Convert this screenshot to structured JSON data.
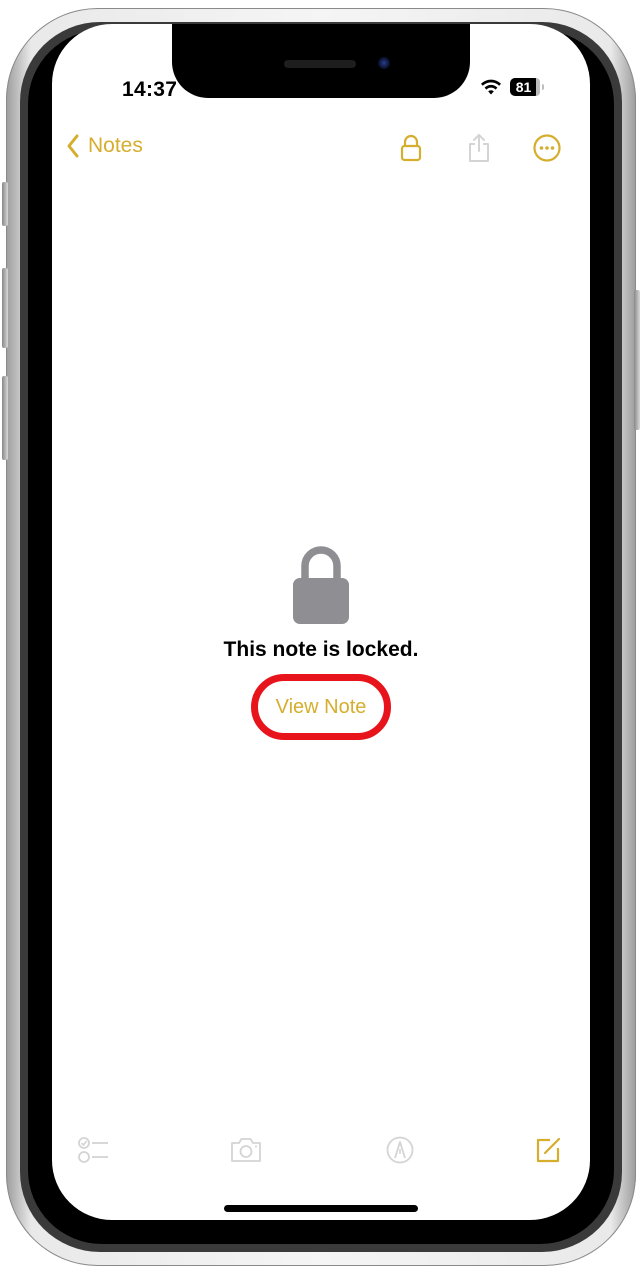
{
  "status_bar": {
    "time": "14:37",
    "battery_level": "81",
    "wifi_icon": "wifi-icon"
  },
  "nav": {
    "back_label": "Notes",
    "back_icon": "chevron-left-icon",
    "actions": [
      {
        "name": "lock",
        "icon": "lock-icon",
        "enabled": true
      },
      {
        "name": "share",
        "icon": "share-icon",
        "enabled": false
      },
      {
        "name": "more",
        "icon": "ellipsis-circle-icon",
        "enabled": true
      }
    ]
  },
  "content": {
    "locked_message": "This note is locked.",
    "view_note_label": "View Note",
    "lock_icon": "lock-icon"
  },
  "toolbar": {
    "items": [
      {
        "name": "checklist",
        "icon": "checklist-icon",
        "enabled": false
      },
      {
        "name": "camera",
        "icon": "camera-icon",
        "enabled": false
      },
      {
        "name": "markup",
        "icon": "markup-pen-icon",
        "enabled": false
      },
      {
        "name": "compose",
        "icon": "compose-icon",
        "enabled": true
      }
    ]
  },
  "colors": {
    "accent": "#d6ae2e",
    "disabled": "#d4d4d4",
    "lock_gray": "#8e8e93",
    "highlight_ring": "#e8141c"
  }
}
